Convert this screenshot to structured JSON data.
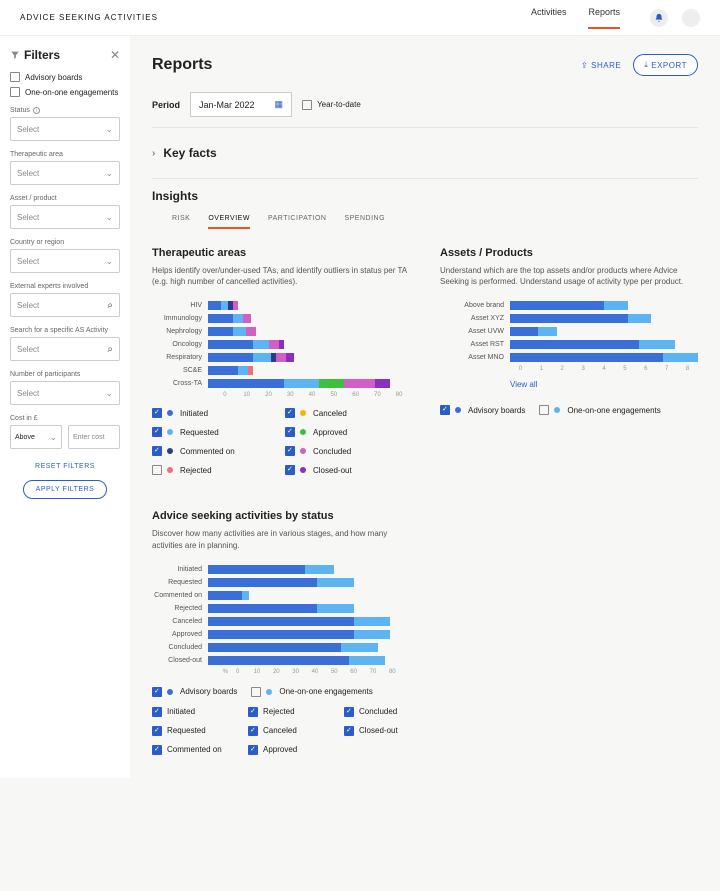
{
  "brand": "ADVICE SEEKING ACTIVITIES",
  "topnav": {
    "activities": "Activities",
    "reports": "Reports"
  },
  "filters": {
    "title": "Filters",
    "advisory_boards": "Advisory boards",
    "one_on_one": "One-on-one engagements",
    "status_lbl": "Status",
    "select_ph": "Select",
    "ta_lbl": "Therapeutic area",
    "asset_lbl": "Asset / product",
    "country_lbl": "Country or region",
    "experts_lbl": "External experts involved",
    "search_lbl": "Search for a specific AS Activity",
    "participants_lbl": "Number of participants",
    "cost_lbl": "Cost in £",
    "above": "Above",
    "enter_cost": "Enter cost",
    "reset": "RESET FILTERS",
    "apply": "APPLY FILTERS"
  },
  "page": {
    "title": "Reports",
    "share": "SHARE",
    "export": "EXPORT",
    "period_lbl": "Period",
    "period_val": "Jan-Mar 2022",
    "ytd": "Year-to-date",
    "keyfacts": "Key facts",
    "insights": "Insights",
    "tabs": {
      "risk": "RISK",
      "overview": "OVERVIEW",
      "participation": "PARTICIPATION",
      "spending": "SPENDING"
    }
  },
  "ta": {
    "title": "Therapeutic areas",
    "desc": "Helps identify over/under-used TAs, and identify outliers in status per TA (e.g. high number of cancelled activities).",
    "statuses": [
      "Initiated",
      "Requested",
      "Commented on",
      "Rejected",
      "Canceled",
      "Approved",
      "Concluded",
      "Closed-out"
    ]
  },
  "ap": {
    "title": "Assets / Products",
    "desc": "Understand which are the top assets and/or products where Advice Seeking is performed. Understand usage of activity type per product.",
    "viewall": "View all",
    "advisory": "Advisory boards",
    "one_on_one": "One-on-one engagements"
  },
  "status": {
    "title": "Advice seeking activities by status",
    "desc": "Discover how many activities are in various stages, and how many activities are in planning."
  },
  "colors": {
    "initiated": "#3a6fd8",
    "requested": "#5cb4f2",
    "commented": "#2e3a8c",
    "rejected": "#ef6f7b",
    "canceled": "#f2b705",
    "approved": "#3fbf3f",
    "concluded": "#d160c4",
    "closed": "#8a2fbf",
    "advisory": "#3a6fd8",
    "one_cl": "#5cb4f2"
  },
  "chart_data": [
    {
      "id": "therapeutic_areas",
      "type": "bar",
      "orientation": "horizontal",
      "stacked": true,
      "xlabel": "",
      "ylabel": "",
      "xlim": [
        0,
        80
      ],
      "xticks": [
        0,
        10,
        20,
        30,
        40,
        50,
        60,
        70,
        80
      ],
      "categories": [
        "HIV",
        "Immunology",
        "Nephrology",
        "Oncology",
        "Respiratory",
        "SC&E",
        "Cross-TA"
      ],
      "series": [
        {
          "name": "Initiated",
          "color": "#3a6fd8",
          "values": [
            5,
            10,
            10,
            18,
            18,
            12,
            30
          ]
        },
        {
          "name": "Requested",
          "color": "#5cb4f2",
          "values": [
            3,
            4,
            5,
            6,
            7,
            4,
            14
          ]
        },
        {
          "name": "Commented on",
          "color": "#2e3a8c",
          "values": [
            2,
            0,
            0,
            0,
            2,
            0,
            0
          ]
        },
        {
          "name": "Rejected",
          "color": "#ef6f7b",
          "values": [
            0,
            0,
            0,
            0,
            0,
            2,
            0
          ]
        },
        {
          "name": "Canceled",
          "color": "#f2b705",
          "values": [
            0,
            0,
            0,
            0,
            0,
            0,
            0
          ]
        },
        {
          "name": "Approved",
          "color": "#3fbf3f",
          "values": [
            0,
            0,
            0,
            0,
            0,
            0,
            10
          ]
        },
        {
          "name": "Concluded",
          "color": "#d160c4",
          "values": [
            2,
            3,
            4,
            4,
            4,
            0,
            12
          ]
        },
        {
          "name": "Closed-out",
          "color": "#8a2fbf",
          "values": [
            0,
            0,
            0,
            2,
            3,
            0,
            6
          ]
        }
      ]
    },
    {
      "id": "assets_products",
      "type": "bar",
      "orientation": "horizontal",
      "stacked": true,
      "xlim": [
        0,
        8
      ],
      "xticks": [
        0,
        1,
        2,
        3,
        4,
        5,
        6,
        7,
        8
      ],
      "categories": [
        "Above brand",
        "Asset XYZ",
        "Asset UVW",
        "Asset RST",
        "Asset MNO"
      ],
      "series": [
        {
          "name": "Advisory boards",
          "color": "#3a6fd8",
          "values": [
            4.0,
            5.0,
            1.2,
            5.5,
            6.5
          ]
        },
        {
          "name": "One-on-one engagements",
          "color": "#5cb4f2",
          "values": [
            1.0,
            1.0,
            0.8,
            1.5,
            1.5
          ]
        }
      ]
    },
    {
      "id": "activities_by_status",
      "type": "bar",
      "orientation": "horizontal",
      "stacked": true,
      "xlabel": "%",
      "xlim": [
        0,
        80
      ],
      "xticks": [
        0,
        10,
        20,
        30,
        40,
        50,
        60,
        70,
        80
      ],
      "categories": [
        "Initiated",
        "Requested",
        "Commented on",
        "Rejected",
        "Canceled",
        "Approved",
        "Concluded",
        "Closed-out"
      ],
      "series": [
        {
          "name": "Advisory boards",
          "color": "#3a6fd8",
          "values": [
            40,
            45,
            14,
            45,
            60,
            60,
            55,
            58
          ]
        },
        {
          "name": "One-on-one engagements",
          "color": "#5cb4f2",
          "values": [
            12,
            15,
            3,
            15,
            15,
            15,
            15,
            15
          ]
        }
      ]
    }
  ]
}
